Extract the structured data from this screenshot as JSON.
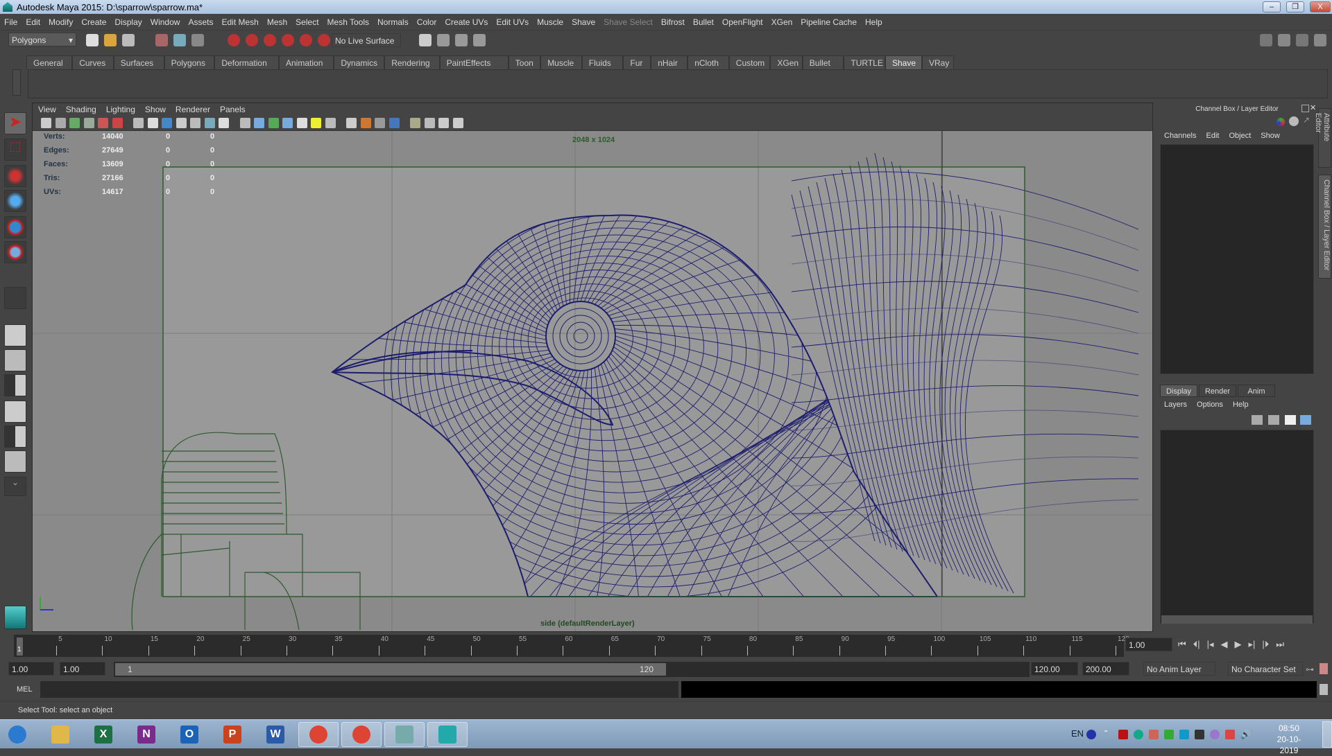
{
  "window": {
    "title": "Autodesk Maya 2015: D:\\sparrow\\sparrow.ma*",
    "min": "–",
    "restore": "❐",
    "close": "X"
  },
  "menus": [
    "File",
    "Edit",
    "Modify",
    "Create",
    "Display",
    "Window",
    "Assets",
    "Edit Mesh",
    "Mesh",
    "Select",
    "Mesh Tools",
    "Normals",
    "Color",
    "Create UVs",
    "Edit UVs",
    "Muscle",
    "Shave",
    "Shave Select",
    "Bifrost",
    "Bullet",
    "OpenFlight",
    "XGen",
    "Pipeline Cache",
    "Help"
  ],
  "statusline": {
    "menuset": "Polygons",
    "live_surface": "No Live Surface"
  },
  "shelf_tabs": [
    "General",
    "Curves",
    "Surfaces",
    "Polygons",
    "Deformation",
    "Animation",
    "Dynamics",
    "Rendering",
    "PaintEffects",
    "Toon",
    "Muscle",
    "Fluids",
    "Fur",
    "nHair",
    "nCloth",
    "Custom",
    "XGen",
    "Bullet",
    "TURTLE",
    "Shave",
    "VRay"
  ],
  "shelf_active": "Shave",
  "viewport": {
    "menus": [
      "View",
      "Shading",
      "Lighting",
      "Show",
      "Renderer",
      "Panels"
    ],
    "stats": [
      {
        "label": "Verts:",
        "v": "14040",
        "a": "0",
        "b": "0"
      },
      {
        "label": "Edges:",
        "v": "27649",
        "a": "0",
        "b": "0"
      },
      {
        "label": "Faces:",
        "v": "13609",
        "a": "0",
        "b": "0"
      },
      {
        "label": "Tris:",
        "v": "27166",
        "a": "0",
        "b": "0"
      },
      {
        "label": "UVs:",
        "v": "14617",
        "a": "0",
        "b": "0"
      }
    ],
    "resolution": "2048 x 1024",
    "camera_label": "side (defaultRenderLayer)",
    "wire_color": "#1c1c6e",
    "gate_color": "#2d5a2d"
  },
  "channelbox": {
    "title": "Channel Box / Layer Editor",
    "menus": [
      "Channels",
      "Edit",
      "Object",
      "Show"
    ],
    "layer_tabs": [
      "Display",
      "Render",
      "Anim"
    ],
    "layer_menus": [
      "Layers",
      "Options",
      "Help"
    ]
  },
  "side_tabs": [
    "Attribute Editor",
    "Channel Box / Layer Editor"
  ],
  "timeline": {
    "ticks": [
      "5",
      "10",
      "15",
      "20",
      "25",
      "30",
      "35",
      "40",
      "45",
      "50",
      "55",
      "60",
      "65",
      "70",
      "75",
      "80",
      "85",
      "90",
      "95",
      "100",
      "105",
      "110",
      "115",
      "120"
    ],
    "start": 1,
    "end": 120,
    "current": "1",
    "current_field": "1.00"
  },
  "range": {
    "start": "1.00",
    "start2": "1.00",
    "slider_min": "1",
    "slider_max": "120",
    "end": "120.00",
    "end2": "200.00",
    "anim_layer": "No Anim Layer",
    "char_set": "No Character Set"
  },
  "mel": {
    "label": "MEL"
  },
  "help_line": "Select Tool: select an object",
  "taskbar": {
    "apps": [
      "windows-start",
      "file-explorer",
      "excel",
      "onenote",
      "outlook",
      "powerpoint",
      "word",
      "chrome",
      "chrome",
      "cclauncher",
      "maya"
    ],
    "lang": "EN",
    "time": "08:50",
    "date": "20-10-2019"
  }
}
